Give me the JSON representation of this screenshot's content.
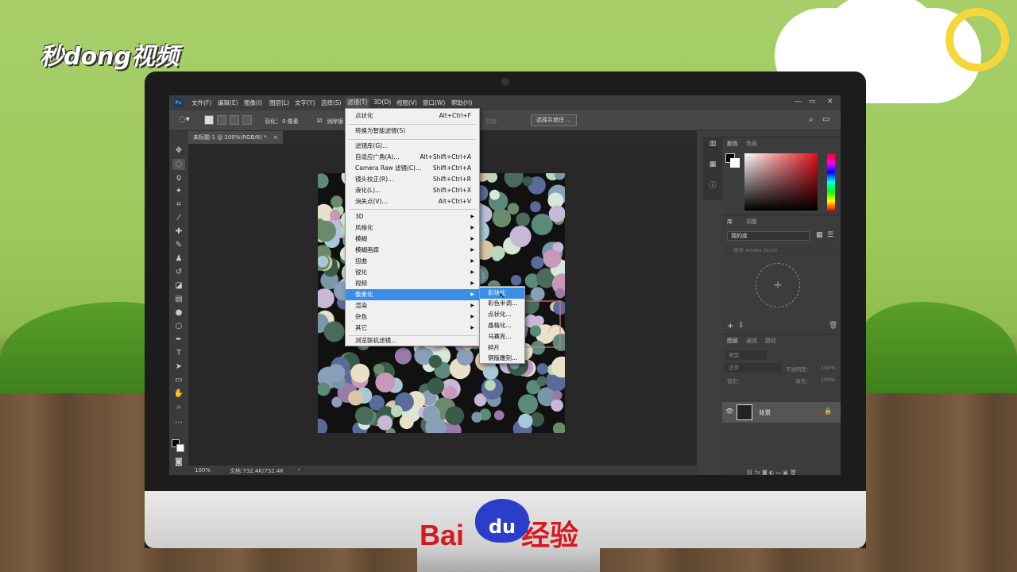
{
  "watermark": {
    "top_logo": "秒dong视频",
    "bottom_logo_left": "Bai",
    "bottom_logo_paw": "du",
    "bottom_logo_right": "经验"
  },
  "menubar": {
    "app_icon": "Ps",
    "items": [
      "文件(F)",
      "编辑(E)",
      "图像(I)",
      "图层(L)",
      "文字(Y)",
      "选择(S)",
      "滤镜(T)",
      "3D(D)",
      "视图(V)",
      "窗口(W)",
      "帮助(H)"
    ],
    "active_item": "滤镜(T)",
    "window_controls": [
      "—",
      "▭",
      "✕"
    ]
  },
  "options_bar": {
    "feather_label": "羽化：",
    "feather_value": "0 像素",
    "antialias_label": "消除锯",
    "style_label": "高度：",
    "select_mask_button": "选择并遮住 ..."
  },
  "document": {
    "tab_title": "未标题-1 @ 100%(RGB/8) *",
    "close": "×",
    "zoom": "100%",
    "doc_info": "文档:732.4K/732.4K",
    "status_arrow": "›"
  },
  "filter_menu": {
    "items": [
      {
        "label": "点状化",
        "shortcut": "Alt+Ctrl+F"
      },
      {
        "label": "转换为智能滤镜(S)",
        "shortcut": ""
      },
      {
        "label": "滤镜库(G)...",
        "shortcut": ""
      },
      {
        "label": "自适应广角(A)...",
        "shortcut": "Alt+Shift+Ctrl+A"
      },
      {
        "label": "Camera Raw 滤镜(C)...",
        "shortcut": "Shift+Ctrl+A"
      },
      {
        "label": "镜头校正(R)...",
        "shortcut": "Shift+Ctrl+R"
      },
      {
        "label": "液化(L)...",
        "shortcut": "Shift+Ctrl+X"
      },
      {
        "label": "消失点(V)...",
        "shortcut": "Alt+Ctrl+V"
      },
      {
        "label": "3D",
        "shortcut": ""
      },
      {
        "label": "风格化",
        "shortcut": ""
      },
      {
        "label": "模糊",
        "shortcut": ""
      },
      {
        "label": "模糊画廊",
        "shortcut": ""
      },
      {
        "label": "扭曲",
        "shortcut": ""
      },
      {
        "label": "锐化",
        "shortcut": ""
      },
      {
        "label": "视频",
        "shortcut": ""
      },
      {
        "label": "像素化",
        "shortcut": ""
      },
      {
        "label": "渲染",
        "shortcut": ""
      },
      {
        "label": "杂色",
        "shortcut": ""
      },
      {
        "label": "其它",
        "shortcut": ""
      },
      {
        "label": "浏览联机滤镜...",
        "shortcut": ""
      }
    ],
    "highlighted": "像素化"
  },
  "pixelate_submenu": {
    "items": [
      "彩块化",
      "彩色半调...",
      "点状化...",
      "晶格化...",
      "马赛克...",
      "碎片",
      "铜版雕刻..."
    ],
    "highlighted": "彩块化"
  },
  "panels": {
    "color_tabs": [
      "颜色",
      "色板"
    ],
    "library_tabs": [
      "库",
      "调整"
    ],
    "library_select": "我的库",
    "library_search_placeholder": "搜索 Adobe Stock",
    "library_plus": "+",
    "layers_tabs": [
      "图层",
      "通道",
      "路径"
    ],
    "layer_kind": "类型",
    "blend_mode": "正常",
    "opacity_label": "不透明度：",
    "opacity_value": "100%",
    "lock_label": "锁定：",
    "fill_label": "填充：",
    "fill_value": "100%",
    "layer_name": "背景"
  },
  "colors": {
    "menu_highlight": "#3a8ee6",
    "ps_dark": "#535353",
    "baidu_red": "#d7191f",
    "baidu_blue": "#2a3ec9"
  }
}
